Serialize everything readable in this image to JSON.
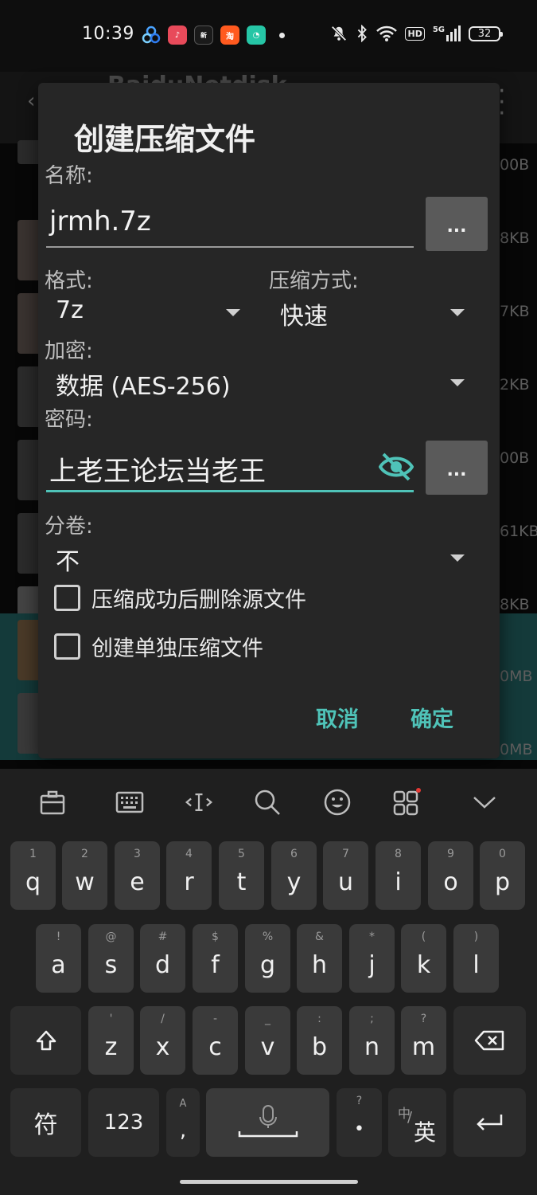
{
  "status_bar": {
    "time": "10:39",
    "app_icons": [
      "cluster-app-icon",
      "music-app-icon",
      "news-app-icon",
      "taobao-app-icon",
      "chat-app-icon"
    ],
    "network": "5G",
    "hd": "HD",
    "battery": "32"
  },
  "background_app": {
    "title": "BaiduNetdisk",
    "sizes": [
      "00B",
      "8KB",
      "7KB",
      "2KB",
      "00B",
      "61KB",
      "8KB",
      "0MB",
      "0MB"
    ]
  },
  "dialog": {
    "title": "创建压缩文件",
    "name_label": "名称:",
    "name_value": "jrmh.7z",
    "browse_button": "...",
    "format_label": "格式:",
    "format_value": "7z",
    "method_label": "压缩方式:",
    "method_value": "快速",
    "encryption_label": "加密:",
    "encryption_value": "数据 (AES-256)",
    "password_label": "密码:",
    "password_value": "上老王论坛当老王",
    "password_button": "...",
    "split_label": "分卷:",
    "split_value": "不",
    "delete_source_label": "压缩成功后删除源文件",
    "delete_source_checked": false,
    "separate_archive_label": "创建单独压缩文件",
    "separate_archive_checked": false,
    "cancel_label": "取消",
    "ok_label": "确定",
    "accent_color": "#4fc3b8"
  },
  "keyboard": {
    "row1": [
      {
        "hint": "1",
        "key": "q"
      },
      {
        "hint": "2",
        "key": "w"
      },
      {
        "hint": "3",
        "key": "e"
      },
      {
        "hint": "4",
        "key": "r"
      },
      {
        "hint": "5",
        "key": "t"
      },
      {
        "hint": "6",
        "key": "y"
      },
      {
        "hint": "7",
        "key": "u"
      },
      {
        "hint": "8",
        "key": "i"
      },
      {
        "hint": "9",
        "key": "o"
      },
      {
        "hint": "0",
        "key": "p"
      }
    ],
    "row2": [
      {
        "hint": "!",
        "key": "a"
      },
      {
        "hint": "@",
        "key": "s"
      },
      {
        "hint": "#",
        "key": "d"
      },
      {
        "hint": "$",
        "key": "f"
      },
      {
        "hint": "%",
        "key": "g"
      },
      {
        "hint": "&",
        "key": "h"
      },
      {
        "hint": "*",
        "key": "j"
      },
      {
        "hint": "(",
        "key": "k"
      },
      {
        "hint": ")",
        "key": "l"
      }
    ],
    "row3": [
      {
        "hint": "'",
        "key": "z"
      },
      {
        "hint": "/",
        "key": "x"
      },
      {
        "hint": "-",
        "key": "c"
      },
      {
        "hint": "_",
        "key": "v"
      },
      {
        "hint": ":",
        "key": "b"
      },
      {
        "hint": ";",
        "key": "n"
      },
      {
        "hint": "?",
        "key": "m"
      }
    ],
    "symbols_key": "符",
    "numbers_key": "123",
    "comma_hint": "A",
    "comma_key": ",",
    "period_hint": "?",
    "period_key": "•",
    "lang_hint": "中",
    "lang_key": "英"
  }
}
